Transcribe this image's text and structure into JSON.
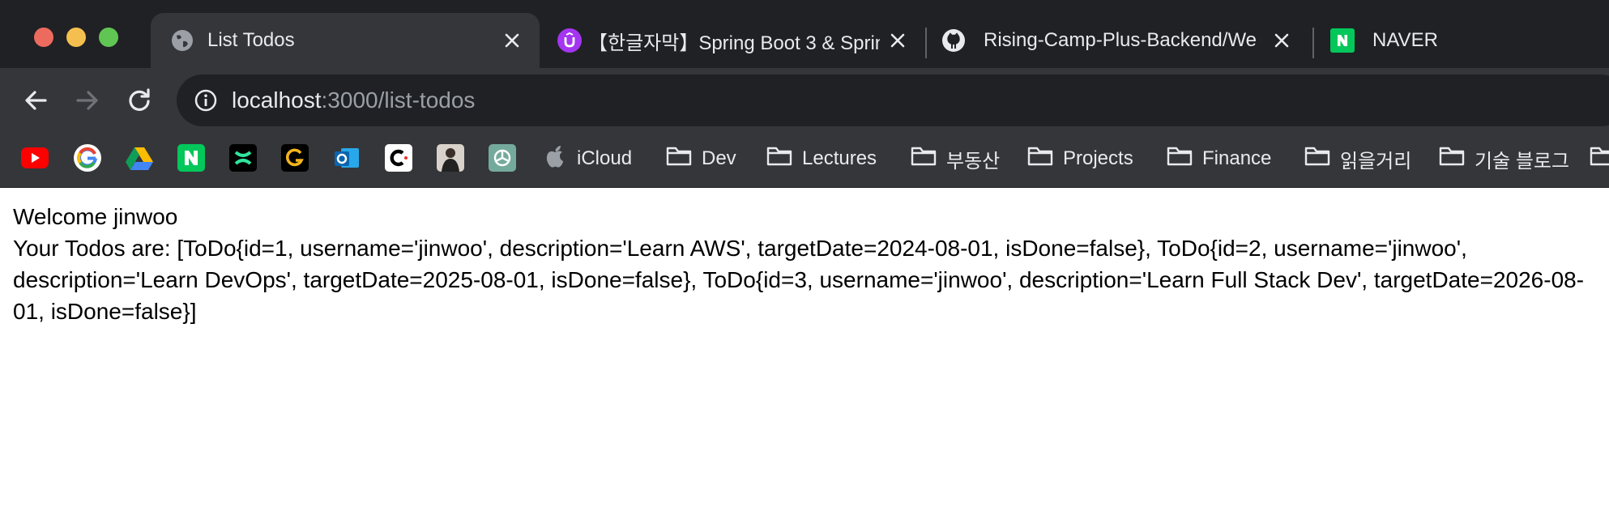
{
  "window": {
    "traffic_lights": [
      "close",
      "minimize",
      "maximize"
    ]
  },
  "tabs": [
    {
      "title": "List Todos",
      "favicon": "globe-icon",
      "active": true
    },
    {
      "title": "【한글자막】Spring Boot 3 & Sprin",
      "favicon": "udemy-icon",
      "active": false
    },
    {
      "title": "Rising-Camp-Plus-Backend/We",
      "favicon": "github-icon",
      "active": false
    },
    {
      "title": "NAVER",
      "favicon": "naver-icon",
      "active": false
    }
  ],
  "toolbar": {
    "url_host": "localhost",
    "url_path": ":3000/list-todos"
  },
  "bookmarks": {
    "icons": [
      "youtube-icon",
      "google-icon",
      "google-drive-icon",
      "naver-icon",
      "green-app-icon",
      "g-app-icon",
      "outlook-icon",
      "c-app-icon",
      "profile-photo-icon",
      "chatgpt-icon"
    ],
    "items": [
      {
        "label": "iCloud",
        "icon": "apple-icon"
      },
      {
        "label": "Dev",
        "icon": "folder-icon"
      },
      {
        "label": "Lectures",
        "icon": "folder-icon"
      },
      {
        "label": "부동산",
        "icon": "folder-icon"
      },
      {
        "label": "Projects",
        "icon": "folder-icon"
      },
      {
        "label": "Finance",
        "icon": "folder-icon"
      },
      {
        "label": "읽을거리",
        "icon": "folder-icon"
      },
      {
        "label": "기술 블로그",
        "icon": "folder-icon"
      }
    ]
  },
  "page": {
    "welcome": "Welcome jinwoo",
    "todos_text": "Your Todos are: [ToDo{id=1, username='jinwoo', description='Learn AWS', targetDate=2024-08-01, isDone=false}, ToDo{id=2, username='jinwoo', description='Learn DevOps', targetDate=2025-08-01, isDone=false}, ToDo{id=3, username='jinwoo', description='Learn Full Stack Dev', targetDate=2026-08-01, isDone=false}]"
  },
  "colors": {
    "tabstrip_bg": "#202124",
    "toolbar_bg": "#35363a",
    "text_light": "#e8eaed",
    "text_dim": "#9aa0a6"
  }
}
